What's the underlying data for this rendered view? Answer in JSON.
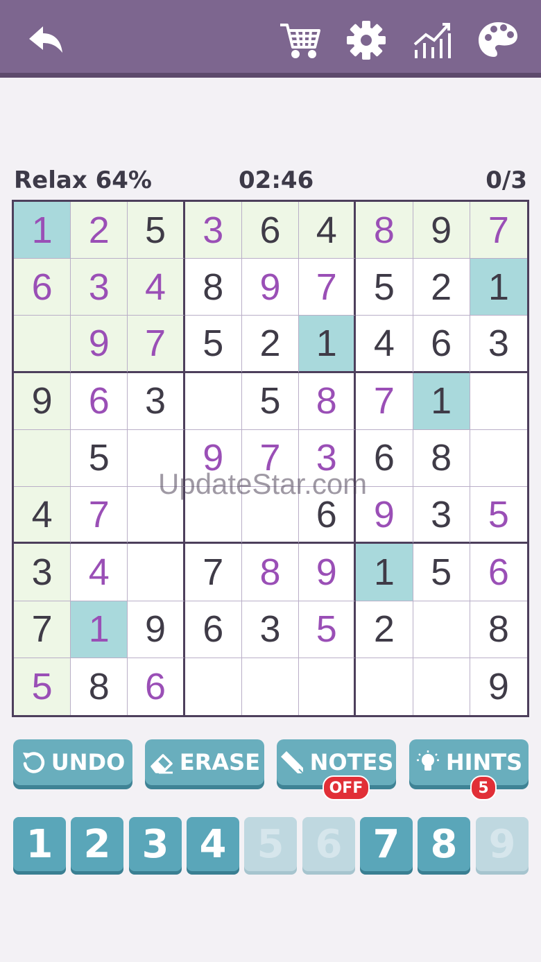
{
  "toolbar": {
    "icons": [
      "back-arrow-icon",
      "shopping-cart-icon",
      "gear-icon",
      "stats-chart-icon",
      "palette-icon"
    ]
  },
  "status": {
    "difficulty": "Relax 64%",
    "timer": "02:46",
    "mistakes": "0/3"
  },
  "board": {
    "values": [
      [
        "1",
        "2",
        "5",
        "3",
        "6",
        "4",
        "8",
        "9",
        "7"
      ],
      [
        "6",
        "3",
        "4",
        "8",
        "9",
        "7",
        "5",
        "2",
        "1"
      ],
      [
        "",
        "9",
        "7",
        "5",
        "2",
        "1",
        "4",
        "6",
        "3"
      ],
      [
        "9",
        "6",
        "3",
        "",
        "5",
        "8",
        "7",
        "1",
        ""
      ],
      [
        "",
        "5",
        "",
        "9",
        "7",
        "3",
        "6",
        "8",
        ""
      ],
      [
        "4",
        "7",
        "",
        "",
        "",
        "6",
        "9",
        "3",
        "5"
      ],
      [
        "3",
        "4",
        "",
        "7",
        "8",
        "9",
        "1",
        "5",
        "6"
      ],
      [
        "7",
        "1",
        "9",
        "6",
        "3",
        "5",
        "2",
        "",
        "8"
      ],
      [
        "5",
        "8",
        "6",
        "",
        "",
        "",
        "",
        "",
        "9"
      ]
    ],
    "user_entered": [
      [
        1,
        1,
        0,
        1,
        0,
        0,
        1,
        0,
        1
      ],
      [
        1,
        1,
        1,
        0,
        1,
        1,
        0,
        0,
        0
      ],
      [
        0,
        1,
        1,
        0,
        0,
        0,
        0,
        0,
        0
      ],
      [
        0,
        1,
        0,
        0,
        0,
        1,
        1,
        0,
        0
      ],
      [
        0,
        0,
        0,
        1,
        1,
        1,
        0,
        0,
        0
      ],
      [
        0,
        1,
        0,
        0,
        0,
        0,
        1,
        0,
        1
      ],
      [
        0,
        1,
        0,
        0,
        1,
        1,
        0,
        0,
        1
      ],
      [
        0,
        1,
        0,
        0,
        0,
        1,
        0,
        0,
        0
      ],
      [
        1,
        0,
        1,
        0,
        0,
        0,
        0,
        0,
        0
      ]
    ],
    "highlight": [
      [
        "teal",
        "green",
        "green",
        "green",
        "green",
        "green",
        "green",
        "green",
        "green"
      ],
      [
        "green",
        "green",
        "green",
        "",
        "",
        "",
        "",
        "",
        "teal"
      ],
      [
        "green",
        "green",
        "green",
        "",
        "",
        "teal",
        "",
        "",
        ""
      ],
      [
        "green",
        "",
        "",
        "",
        "",
        "",
        "",
        "teal",
        ""
      ],
      [
        "green",
        "",
        "",
        "",
        "",
        "",
        "",
        "",
        ""
      ],
      [
        "green",
        "",
        "",
        "",
        "",
        "",
        "",
        "",
        ""
      ],
      [
        "green",
        "",
        "",
        "",
        "",
        "",
        "teal",
        "",
        ""
      ],
      [
        "green",
        "teal",
        "",
        "",
        "",
        "",
        "",
        "",
        ""
      ],
      [
        "green",
        "",
        "",
        "",
        "",
        "",
        "",
        "",
        ""
      ]
    ]
  },
  "watermark": "UpdateStar.com",
  "actions": {
    "undo": {
      "label": "UNDO",
      "icon": "undo-icon"
    },
    "erase": {
      "label": "ERASE",
      "icon": "eraser-icon"
    },
    "notes": {
      "label": "NOTES",
      "icon": "pencil-icon",
      "badge": "OFF"
    },
    "hints": {
      "label": "HINTS",
      "icon": "lightbulb-icon",
      "badge": "5"
    }
  },
  "numpad": [
    {
      "label": "1",
      "completed": false
    },
    {
      "label": "2",
      "completed": false
    },
    {
      "label": "3",
      "completed": false
    },
    {
      "label": "4",
      "completed": false
    },
    {
      "label": "5",
      "completed": true
    },
    {
      "label": "6",
      "completed": true
    },
    {
      "label": "7",
      "completed": false
    },
    {
      "label": "8",
      "completed": false
    },
    {
      "label": "9",
      "completed": true
    }
  ],
  "colors": {
    "header": "#7d668f",
    "user_digit": "#9a4fb6",
    "highlight_green": "#eef7e6",
    "highlight_teal": "#a9d9dc",
    "button": "#69aebd",
    "badge": "#e12f37"
  }
}
